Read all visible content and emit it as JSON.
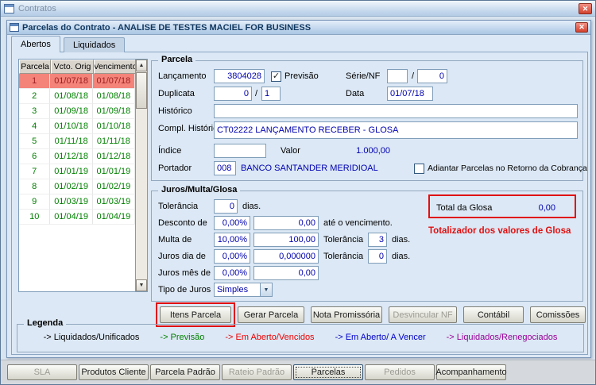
{
  "window": {
    "title": "Contratos"
  },
  "dialog": {
    "title": "Parcelas do Contrato - ANALISE DE TESTES MACIEL FOR BUSINESS",
    "tabs": [
      {
        "label": "Abertos",
        "active": true
      },
      {
        "label": "Liquidados",
        "active": false
      }
    ]
  },
  "icons": {
    "close": "✕",
    "check": "✓",
    "dropdown_arrow": "▼",
    "scroll_up": "▲",
    "scroll_down": "▼"
  },
  "grid": {
    "columns": [
      "Parcela",
      "Vcto. Orig",
      "Vencimento"
    ],
    "rows": [
      {
        "parcela": "1",
        "vcto_orig": "01/07/18",
        "vencimento": "01/07/18",
        "selected": true
      },
      {
        "parcela": "2",
        "vcto_orig": "01/08/18",
        "vencimento": "01/08/18"
      },
      {
        "parcela": "3",
        "vcto_orig": "01/09/18",
        "vencimento": "01/09/18"
      },
      {
        "parcela": "4",
        "vcto_orig": "01/10/18",
        "vencimento": "01/10/18"
      },
      {
        "parcela": "5",
        "vcto_orig": "01/11/18",
        "vencimento": "01/11/18"
      },
      {
        "parcela": "6",
        "vcto_orig": "01/12/18",
        "vencimento": "01/12/18"
      },
      {
        "parcela": "7",
        "vcto_orig": "01/01/19",
        "vencimento": "01/01/19"
      },
      {
        "parcela": "8",
        "vcto_orig": "01/02/19",
        "vencimento": "01/02/19"
      },
      {
        "parcela": "9",
        "vcto_orig": "01/03/19",
        "vencimento": "01/03/19"
      },
      {
        "parcela": "10",
        "vcto_orig": "01/04/19",
        "vencimento": "01/04/19"
      }
    ]
  },
  "parcela_group": {
    "title": "Parcela",
    "fields": {
      "lancamento": {
        "label": "Lançamento",
        "value": "3804028"
      },
      "previsao": {
        "label": "Previsão",
        "checked": true
      },
      "serie_nf": {
        "label": "Série/NF",
        "serie": "",
        "separator": "/",
        "nf": "0"
      },
      "duplicata": {
        "label": "Duplicata",
        "num": "0",
        "separator": "/",
        "seq": "1"
      },
      "data": {
        "label": "Data",
        "value": "01/07/18"
      },
      "historico": {
        "label": "Histórico",
        "value": ""
      },
      "compl_historico": {
        "label": "Compl. Histórico",
        "value": "CT02222 LANÇAMENTO RECEBER - GLOSA"
      },
      "indice": {
        "label": "Índice",
        "value": ""
      },
      "valor": {
        "label": "Valor",
        "value": "1.000,00"
      },
      "portador": {
        "label": "Portador",
        "value": "008",
        "descricao": "BANCO SANTANDER MERIDIOAL"
      },
      "adiantar": {
        "label": "Adiantar Parcelas no Retorno da Cobrança",
        "checked": false
      }
    }
  },
  "juros_group": {
    "title": "Juros/Multa/Glosa",
    "tolerancia": {
      "label": "Tolerância",
      "value": "0",
      "suffix": "dias."
    },
    "desconto": {
      "label": "Desconto de",
      "pct": "0,00%",
      "valor": "0,00",
      "suffix": "até o vencimento."
    },
    "multa": {
      "label": "Multa de",
      "pct": "10,00%",
      "valor": "100,00",
      "tolerancia_label": "Tolerância",
      "tolerancia": "3",
      "suffix": "dias."
    },
    "juros_dia": {
      "label": "Juros dia de",
      "pct": "0,00%",
      "valor": "0,000000",
      "tolerancia_label": "Tolerância",
      "tolerancia": "0",
      "suffix": "dias."
    },
    "juros_mes": {
      "label": "Juros mês de",
      "pct": "0,00%",
      "valor": "0,00"
    },
    "tipo_juros": {
      "label": "Tipo de Juros",
      "value": "Simples"
    },
    "total_glosa": {
      "label": "Total da Glosa",
      "value": "0,00"
    },
    "annotation": "Totalizador dos valores de Glosa"
  },
  "action_buttons": [
    {
      "label": "Itens Parcela",
      "name": "itens-parcela-button",
      "highlighted": true
    },
    {
      "label": "Gerar Parcela",
      "name": "gerar-parcela-button"
    },
    {
      "label": "Nota Promissória",
      "name": "nota-promissoria-button"
    },
    {
      "label": "Desvincular NF",
      "name": "desvincular-nf-button",
      "disabled": true
    },
    {
      "label": "Contábil",
      "name": "contabil-button"
    },
    {
      "label": "Comissões",
      "name": "comissoes-button"
    }
  ],
  "legend": {
    "title": "Legenda",
    "items": [
      {
        "label": "-> Liquidados/Unificados",
        "color": "#000000"
      },
      {
        "label": "-> Previsão",
        "color": "#008000"
      },
      {
        "label": "-> Em Aberto/Vencidos",
        "color": "#ee0000"
      },
      {
        "label": "-> Em Aberto/ A Vencer",
        "color": "#0000cc"
      },
      {
        "label": "-> Liquidados/Renegociados",
        "color": "#990099"
      }
    ]
  },
  "bottom_buttons": [
    {
      "label": "SLA",
      "name": "sla-button",
      "disabled": true
    },
    {
      "label": "Produtos Cliente",
      "name": "produtos-cliente-button"
    },
    {
      "label": "Parcela Padrão",
      "name": "parcela-padrao-button"
    },
    {
      "label": "Rateio Padrão",
      "name": "rateio-padrao-button",
      "disabled": true
    },
    {
      "label": "Parcelas",
      "name": "parcelas-button",
      "focused": true
    },
    {
      "label": "Pedidos",
      "name": "pedidos-button",
      "disabled": true
    },
    {
      "label": "Acompanhamento",
      "name": "acompanhamento-button"
    }
  ],
  "colors": {
    "selected_row_bg": "#f4837a",
    "selected_row_text": "#9c2020",
    "previsao_row_text": "#008000",
    "field_value_text": "#0000b0",
    "annotation_red": "#e01010"
  }
}
